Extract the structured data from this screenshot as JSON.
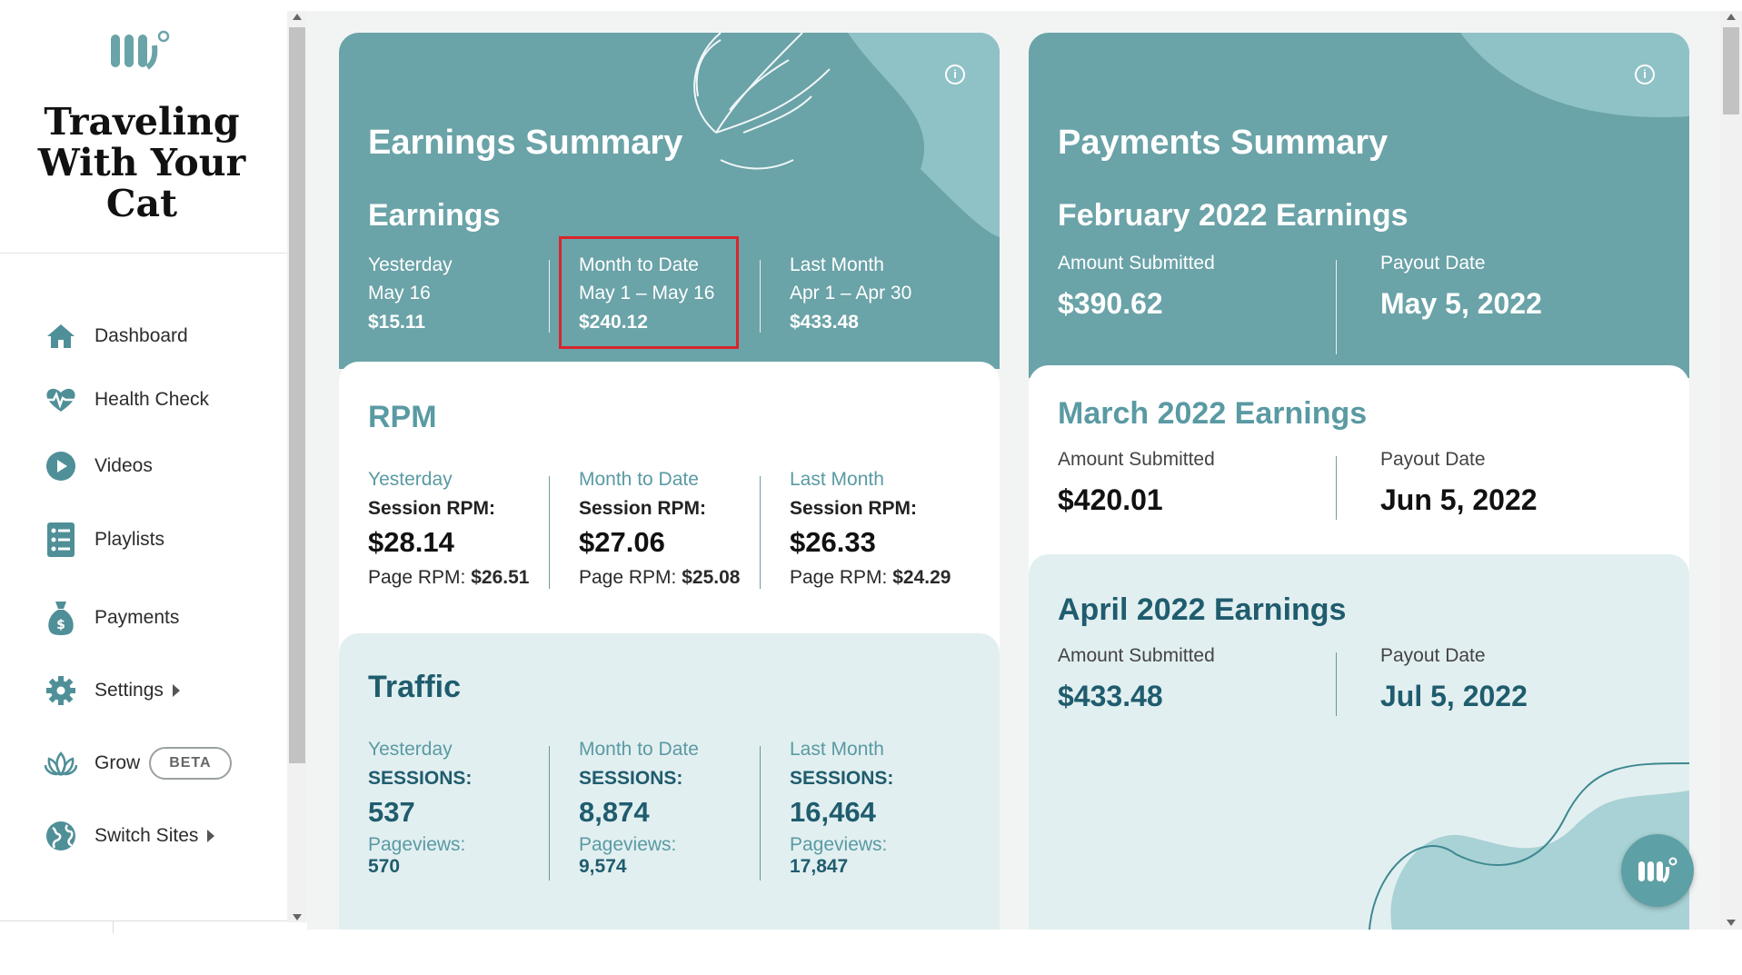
{
  "site": {
    "title_line1": "Traveling",
    "title_line2": "With Your",
    "title_line3": "Cat"
  },
  "nav": {
    "dashboard": "Dashboard",
    "health_check": "Health Check",
    "videos": "Videos",
    "playlists": "Playlists",
    "payments": "Payments",
    "settings": "Settings",
    "grow": "Grow",
    "grow_badge": "BETA",
    "switch_sites": "Switch Sites"
  },
  "colors": {
    "teal": "#6aa3a8",
    "teal_dark": "#1f5c6e",
    "teal_text": "#5a9aa3",
    "light": "#e2eff0",
    "highlight": "#d9262c"
  },
  "earnings": {
    "title": "Earnings Summary",
    "subtitle": "Earnings",
    "yesterday": {
      "label": "Yesterday",
      "date": "May 16",
      "value": "$15.11"
    },
    "mtd": {
      "label": "Month to Date",
      "date": "May 1 – May 16",
      "value": "$240.12"
    },
    "last_month": {
      "label": "Last Month",
      "date": "Apr 1 – Apr 30",
      "value": "$433.48"
    }
  },
  "rpm": {
    "title": "RPM",
    "session_label": "Session RPM:",
    "page_label": "Page RPM:",
    "yesterday": {
      "label": "Yesterday",
      "session": "$28.14",
      "page": "$26.51"
    },
    "mtd": {
      "label": "Month to Date",
      "session": "$27.06",
      "page": "$25.08"
    },
    "last_month": {
      "label": "Last Month",
      "session": "$26.33",
      "page": "$24.29"
    }
  },
  "traffic": {
    "title": "Traffic",
    "sessions_label": "SESSIONS:",
    "pageviews_label": "Pageviews:",
    "yesterday": {
      "label": "Yesterday",
      "sessions": "537",
      "pageviews": "570"
    },
    "mtd": {
      "label": "Month to Date",
      "sessions": "8,874",
      "pageviews": "9,574"
    },
    "last_month": {
      "label": "Last Month",
      "sessions": "16,464",
      "pageviews": "17,847"
    }
  },
  "payments": {
    "title": "Payments Summary",
    "amount_label": "Amount Submitted",
    "payout_label": "Payout Date",
    "feb": {
      "title": "February 2022 Earnings",
      "amount": "$390.62",
      "date": "May 5, 2022"
    },
    "mar": {
      "title": "March 2022 Earnings",
      "amount": "$420.01",
      "date": "Jun 5, 2022"
    },
    "apr": {
      "title": "April 2022 Earnings",
      "amount": "$433.48",
      "date": "Jul 5, 2022"
    }
  },
  "icons": {
    "info": "i",
    "dashboard": "home-icon",
    "health": "heartbeat-icon",
    "videos": "play-circle-icon",
    "playlists": "list-icon",
    "payments": "money-bag-icon",
    "settings": "gear-icon",
    "grow": "lotus-icon",
    "switch": "globe-icon"
  }
}
